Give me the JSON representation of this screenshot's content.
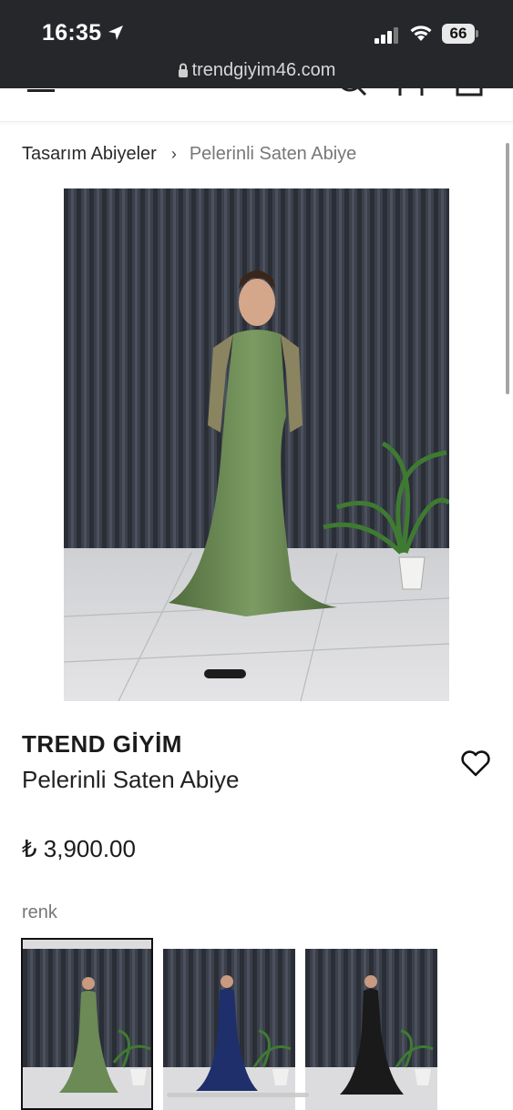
{
  "status_bar": {
    "time": "16:35",
    "battery": "66",
    "url": "trendgiyim46.com"
  },
  "breadcrumb": {
    "parent": "Tasarım Abiyeler",
    "separator": "›",
    "current": "Pelerinli Saten Abiye"
  },
  "product": {
    "brand": "TREND GİYİM",
    "name": "Pelerinli Saten Abiye",
    "price": "₺ 3,900.00",
    "option_label": "renk",
    "variants": [
      {
        "color": "green",
        "dress_hex": "#6b8a55"
      },
      {
        "color": "navy",
        "dress_hex": "#1f2f6b"
      },
      {
        "color": "black",
        "dress_hex": "#1a1a1a"
      }
    ]
  },
  "colors": {
    "status_bg": "#25272a",
    "curtain": "#3a3f4a",
    "floor": "#d9d9dc",
    "dress_green": "#6b8a55"
  }
}
